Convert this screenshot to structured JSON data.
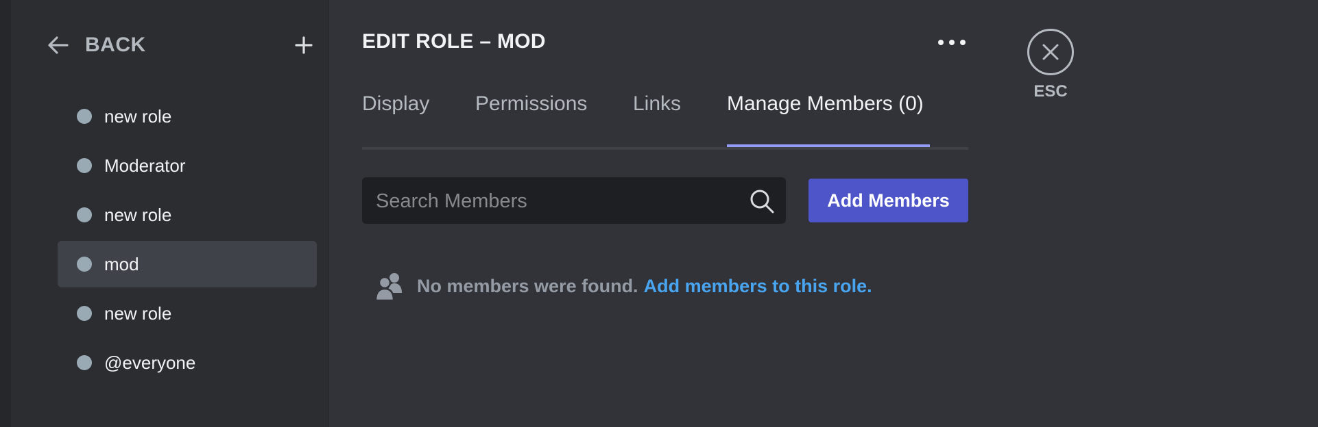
{
  "sidebar": {
    "back_label": "BACK",
    "roles": [
      {
        "name": "new role",
        "color": "#99aab5"
      },
      {
        "name": "Moderator",
        "color": "#99aab5"
      },
      {
        "name": "new role",
        "color": "#99aab5"
      },
      {
        "name": "mod",
        "color": "#99aab5",
        "selected": true
      },
      {
        "name": "new role",
        "color": "#99aab5"
      },
      {
        "name": "@everyone",
        "color": "#99aab5"
      }
    ]
  },
  "header": {
    "title": "EDIT ROLE – MOD"
  },
  "tabs": [
    {
      "label": "Display"
    },
    {
      "label": "Permissions"
    },
    {
      "label": "Links"
    },
    {
      "label": "Manage Members (0)",
      "active": true
    }
  ],
  "members": {
    "search_placeholder": "Search Members",
    "add_button_label": "Add Members",
    "empty_message": "No members were found.",
    "empty_link": "Add members to this role."
  },
  "close": {
    "esc_label": "ESC"
  },
  "colors": {
    "accent_button": "#4e55c8",
    "tab_indicator": "#949cf7",
    "link": "#4aa5f0"
  },
  "icons": {
    "back": "arrow-left-icon",
    "add": "plus-icon",
    "more": "more-horizontal-icon",
    "search": "search-icon",
    "members": "members-icon",
    "close": "close-icon"
  }
}
